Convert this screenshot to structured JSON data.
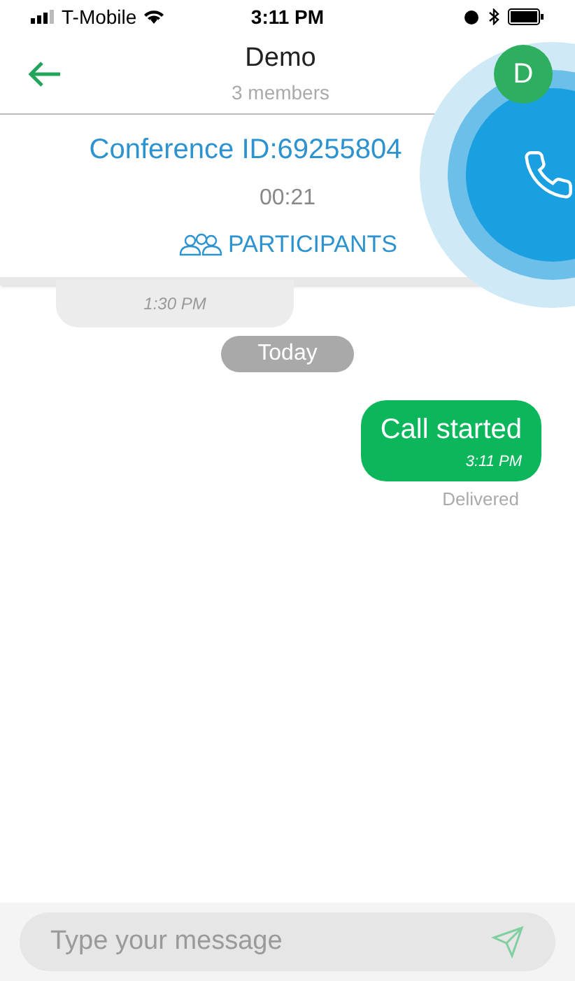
{
  "status_bar": {
    "carrier": "T-Mobile",
    "time": "3:11 PM"
  },
  "header": {
    "title": "Demo",
    "subtitle": "3 members",
    "avatar": "D"
  },
  "conference": {
    "id_label": "Conference ID:69255804",
    "timer": "00:21",
    "participants": "PARTICIPANTS"
  },
  "messages": [
    {
      "kind": "incoming",
      "time": "1:30 PM"
    },
    {
      "kind": "date",
      "text": "Today"
    },
    {
      "kind": "outgoing",
      "text": "Call started",
      "time": "3:11 PM",
      "status": "Delivered"
    }
  ],
  "composer": {
    "placeholder": "Type your message"
  }
}
